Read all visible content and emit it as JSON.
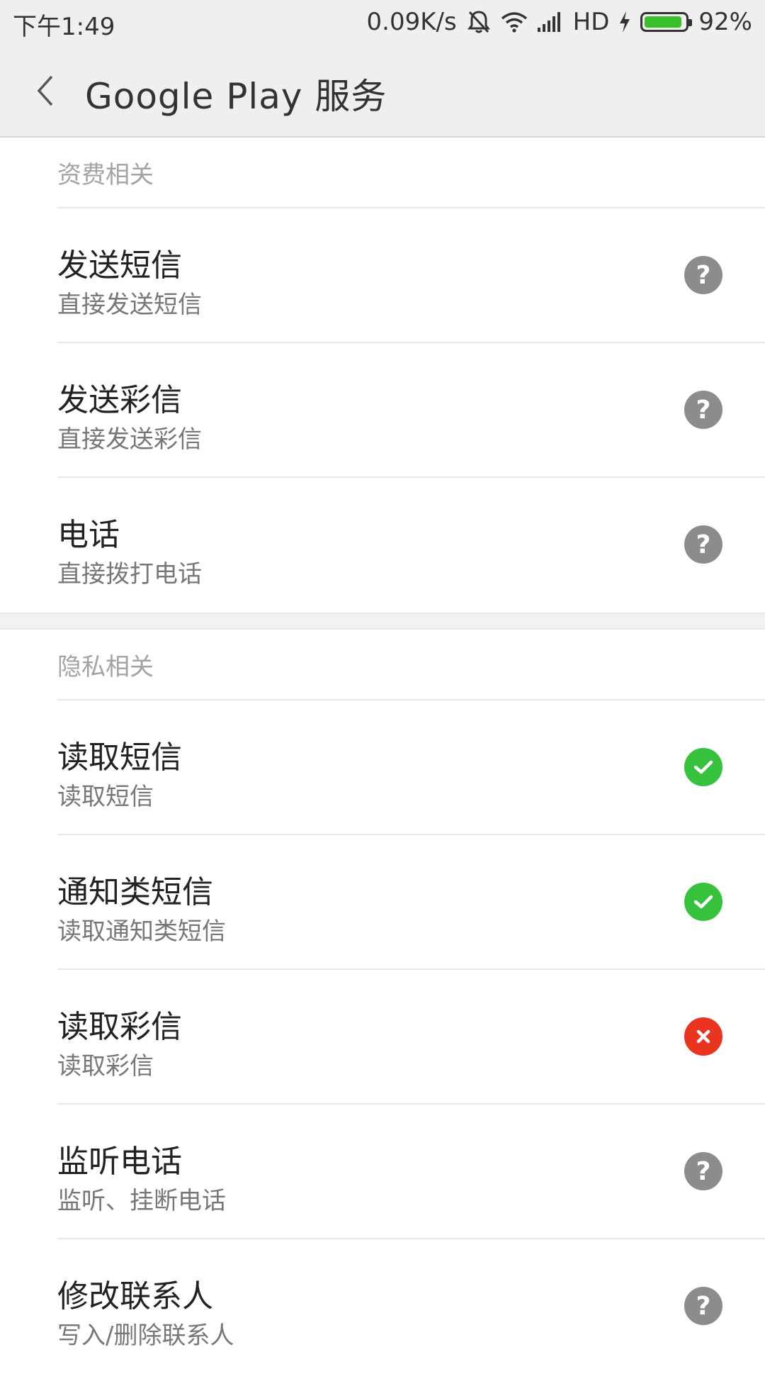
{
  "status_bar": {
    "time": "下午1:49",
    "network_speed": "0.09K/s",
    "hd_label": "HD",
    "battery": "92%",
    "battery_level": 0.92
  },
  "header": {
    "title": "Google Play 服务"
  },
  "sections": [
    {
      "title": "资费相关",
      "items": [
        {
          "title": "发送短信",
          "subtitle": "直接发送短信",
          "status": "ask"
        },
        {
          "title": "发送彩信",
          "subtitle": "直接发送彩信",
          "status": "ask"
        },
        {
          "title": "电话",
          "subtitle": "直接拨打电话",
          "status": "ask"
        }
      ]
    },
    {
      "title": "隐私相关",
      "items": [
        {
          "title": "读取短信",
          "subtitle": "读取短信",
          "status": "allowed"
        },
        {
          "title": "通知类短信",
          "subtitle": "读取通知类短信",
          "status": "allowed"
        },
        {
          "title": "读取彩信",
          "subtitle": "读取彩信",
          "status": "denied"
        },
        {
          "title": "监听电话",
          "subtitle": "监听、挂断电话",
          "status": "ask"
        },
        {
          "title": "修改联系人",
          "subtitle": "写入/删除联系人",
          "status": "ask"
        }
      ]
    }
  ],
  "colors": {
    "allowed": "#36c23c",
    "denied": "#e9341f",
    "ask": "#8c8c8c"
  },
  "icons": {
    "ask": "question-icon",
    "allowed": "check-icon",
    "denied": "cross-icon"
  }
}
